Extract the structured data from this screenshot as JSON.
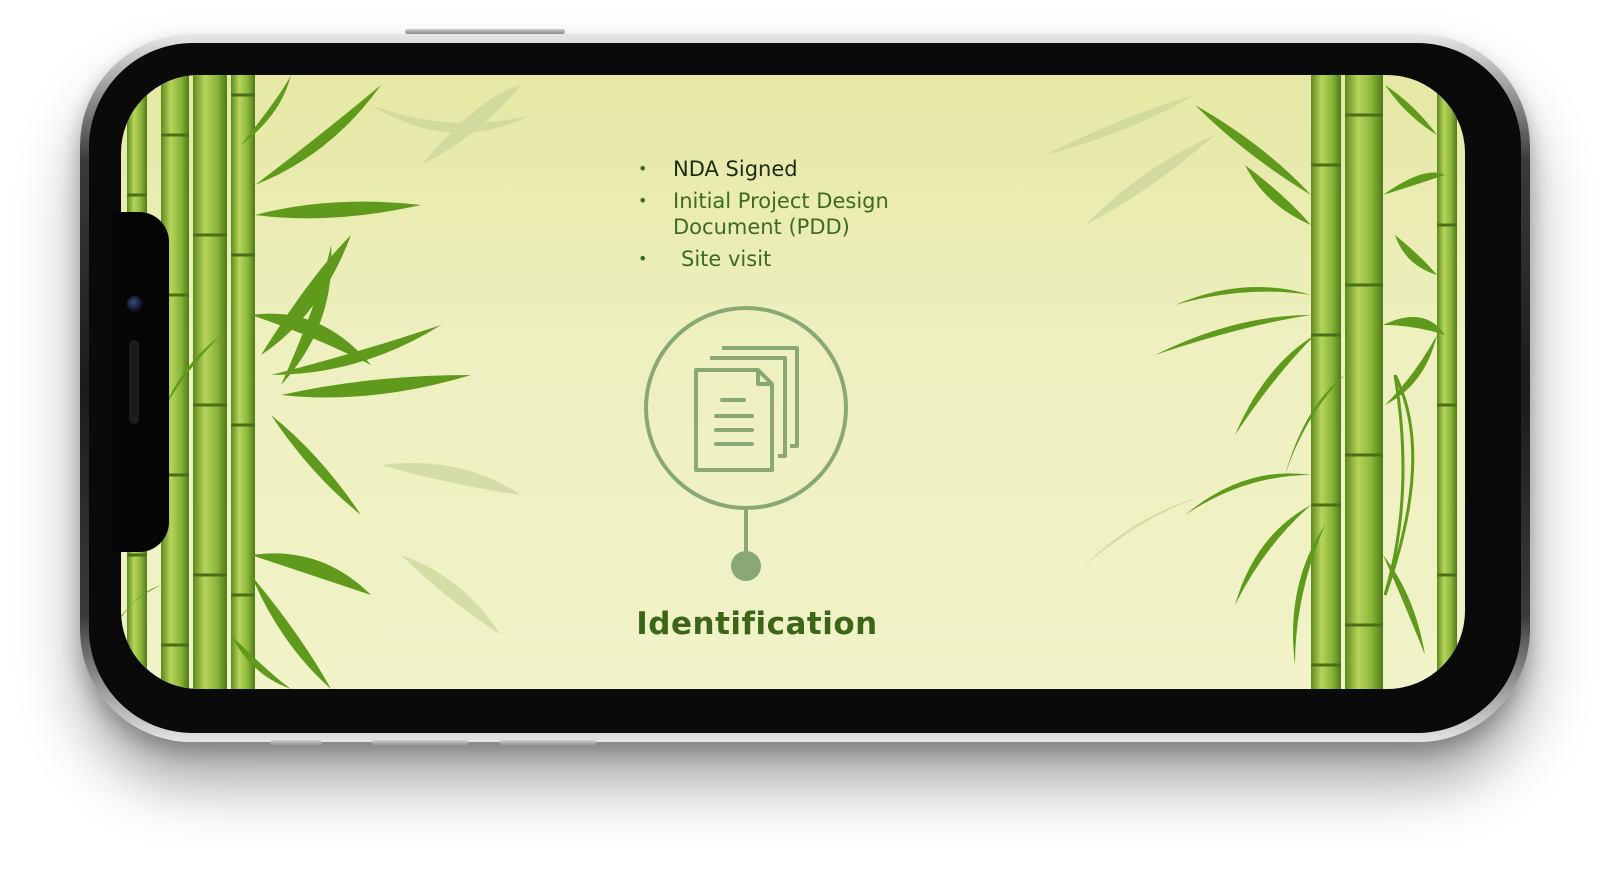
{
  "slide": {
    "bullets": [
      {
        "text": "NDA Signed"
      },
      {
        "text": "Initial Project Design Document (PDD)"
      },
      {
        "text": "Site visit"
      }
    ],
    "bullet_symbol": "•",
    "icon": "documents-icon",
    "title": "Identification"
  },
  "colors": {
    "screen_background": "#eef0c0",
    "accent_green": "#3b6517",
    "icon_green": "#8aa876",
    "bamboo_green": "#7fa83a"
  }
}
